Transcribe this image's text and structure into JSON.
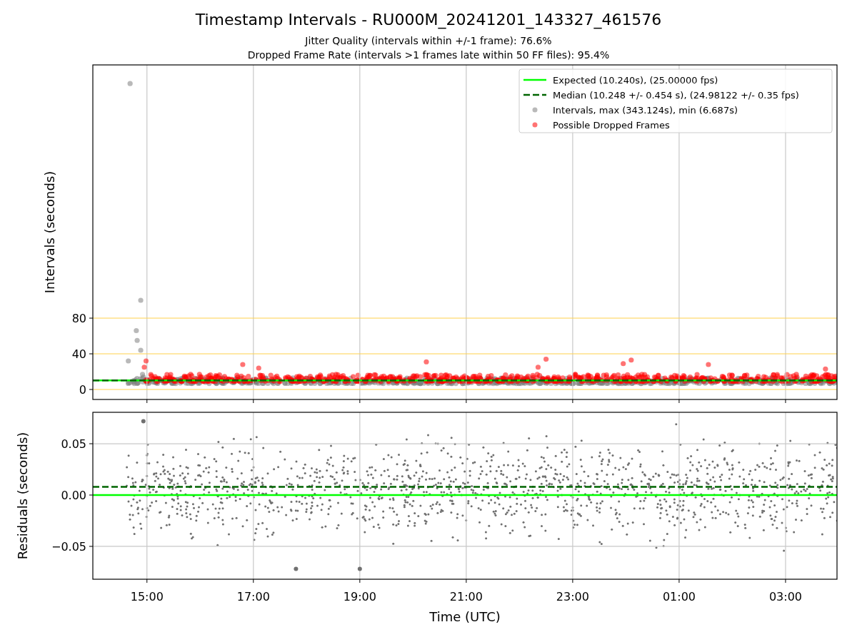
{
  "figure": {
    "title": "Timestamp Intervals - RU000M_20241201_143327_461576",
    "subtitles": [
      "Jitter Quality (intervals within +/-1 frame): 76.6%",
      "Dropped Frame Rate (intervals >1 frames late within 50 FF files): 95.4%"
    ]
  },
  "charts": [
    {
      "chart_data": {
        "type": "scatter",
        "ylabel": "Intervals (seconds)",
        "xlim": [
          "2024-12-01T13:59",
          "2024-12-02T03:58"
        ],
        "ylim": [
          -11.2,
          364
        ],
        "yticks": [
          {
            "value": 0,
            "label": "0"
          },
          {
            "value": 40,
            "label": "40"
          },
          {
            "value": 80,
            "label": "80"
          }
        ],
        "grid": true,
        "legend": true,
        "series": [
          {
            "name": "Intervals, max (343.124s), min (6.687s)",
            "type": "scatter",
            "color": "#808080",
            "x": [
              "2024-12-01T14:41",
              "2024-12-01T14:53",
              "2024-12-01T14:48",
              "2024-12-01T14:49",
              "2024-12-01T14:53",
              "2024-12-01T14:39",
              "2024-12-01T14:55",
              "2024-12-01T14:56"
            ],
            "values": [
              343.1,
              100,
              66,
              55,
              44,
              32,
              17,
              14
            ]
          },
          {
            "name": "Possible Dropped Frames",
            "type": "scatter",
            "color": "#ff0000",
            "x": [
              "2024-12-01T14:59",
              "2024-12-01T14:57",
              "2024-12-01T16:48",
              "2024-12-01T17:06",
              "2024-12-01T20:15",
              "2024-12-01T22:21",
              "2024-12-01T22:30",
              "2024-12-01T23:57",
              "2024-12-02T00:06",
              "2024-12-02T01:33",
              "2024-12-02T03:45"
            ],
            "values": [
              32,
              25,
              28,
              24,
              31,
              25,
              34,
              29,
              33,
              28,
              23
            ]
          },
          {
            "name": "Expected (10.240s), (25.00000 fps)",
            "type": "line",
            "color": "#00ff00",
            "x": [
              "2024-12-01T13:59",
              "2024-12-02T03:58"
            ],
            "values": [
              10.24,
              10.24
            ]
          },
          {
            "name": "Median (10.248 +/- 0.454 s), (24.98122 +/- 0.35 fps)",
            "type": "line",
            "line_style": "dashed",
            "color": "#006400",
            "x": [
              "2024-12-01T13:59",
              "2024-12-02T03:58"
            ],
            "values": [
              10.248,
              10.248
            ]
          }
        ]
      }
    },
    {
      "chart_data": {
        "type": "scatter",
        "grid": true,
        "xlabel": "Time (UTC)",
        "ylabel": "Residuals (seconds)",
        "xlim": [
          "2024-12-01T13:59",
          "2024-12-02T03:58"
        ],
        "ylim": [
          -0.082,
          0.0806
        ],
        "xticks": [
          {
            "value": "2024-12-01T15:00",
            "label": "15:00"
          },
          {
            "value": "2024-12-01T17:00",
            "label": "17:00"
          },
          {
            "value": "2024-12-01T19:00",
            "label": "19:00"
          },
          {
            "value": "2024-12-01T21:00",
            "label": "21:00"
          },
          {
            "value": "2024-12-01T23:00",
            "label": "23:00"
          },
          {
            "value": "2024-12-02T01:00",
            "label": "01:00"
          },
          {
            "value": "2024-12-02T03:00",
            "label": "03:00"
          }
        ],
        "yticks": [
          {
            "value": -0.05,
            "label": "−0.05"
          },
          {
            "value": 0,
            "label": "0.00"
          },
          {
            "value": 0.05,
            "label": "0.05"
          }
        ],
        "series": [
          {
            "type": "scatter",
            "color": "#707070",
            "x": [
              "2024-12-01T14:56",
              "2024-12-01T17:48",
              "2024-12-01T19:00"
            ],
            "values": [
              0.072,
              -0.072,
              -0.072
            ]
          },
          {
            "type": "line",
            "color": "#00ff00",
            "x": [
              "2024-12-01T13:59",
              "2024-12-02T03:58"
            ],
            "values": [
              0,
              0
            ]
          },
          {
            "type": "line",
            "line_style": "dashed",
            "color": "#006400",
            "x": [
              "2024-12-01T13:59",
              "2024-12-02T03:58"
            ],
            "values": [
              0.008,
              0.008
            ]
          }
        ]
      }
    }
  ]
}
